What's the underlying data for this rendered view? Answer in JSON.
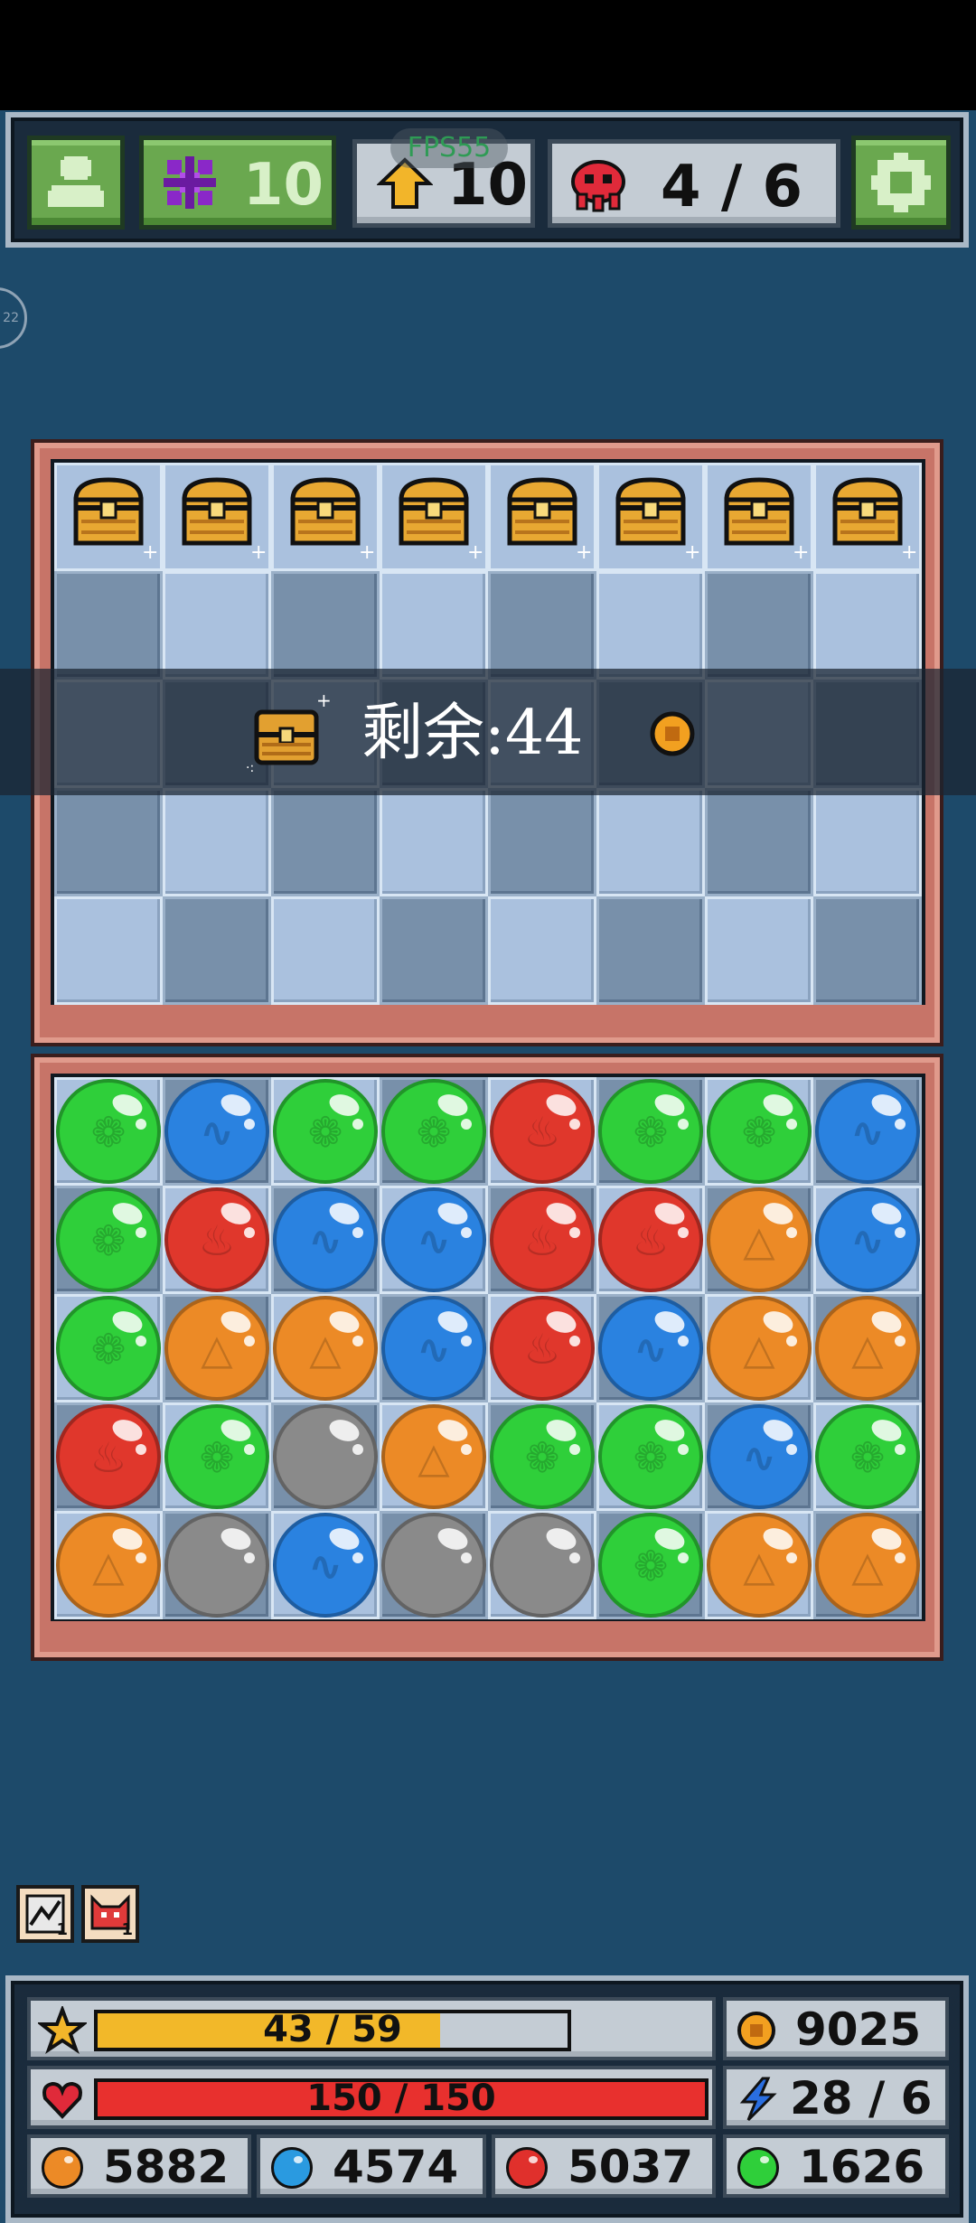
{
  "hud_top": {
    "fps_label": "FPS55",
    "shards": "10",
    "level": "10",
    "enemies": "4 / 6"
  },
  "side_badge": "22",
  "chest_board": {
    "remaining_label": "剩余:44"
  },
  "orb_board": {
    "rows": [
      [
        "green",
        "blue",
        "green",
        "green",
        "red",
        "green",
        "green",
        "blue"
      ],
      [
        "green",
        "red",
        "blue",
        "blue",
        "red",
        "red",
        "orange",
        "blue"
      ],
      [
        "green",
        "orange",
        "orange",
        "blue",
        "red",
        "blue",
        "orange",
        "orange"
      ],
      [
        "red",
        "green",
        "gray",
        "orange",
        "green",
        "green",
        "blue",
        "green"
      ],
      [
        "orange",
        "gray",
        "blue",
        "gray",
        "gray",
        "green",
        "orange",
        "orange"
      ]
    ],
    "colors": {
      "green": "#2fcf3a",
      "blue": "#2a82e0",
      "red": "#e0372c",
      "orange": "#ec8a26",
      "gray": "#8a8a8a"
    }
  },
  "inventory": {
    "items": [
      {
        "name": "map-scroll",
        "count": "1"
      },
      {
        "name": "red-cat",
        "count": "1"
      }
    ]
  },
  "hud_bottom": {
    "xp": {
      "text": "43 / 59",
      "fraction": 0.729
    },
    "hp": {
      "text": "150 / 150",
      "fraction": 1.0
    },
    "gold": "9025",
    "speed": "28 / 6",
    "orange_res": "5882",
    "blue_res": "4574",
    "red_res": "5037",
    "green_res": "1626"
  }
}
